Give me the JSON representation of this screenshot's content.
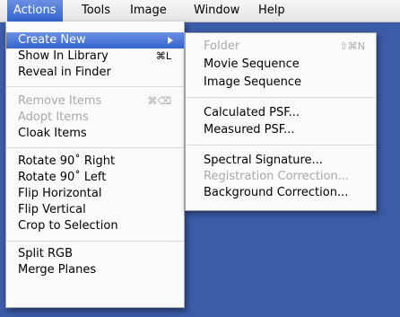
{
  "menubar": {
    "items": [
      "Actions",
      "Tools",
      "Image",
      "Window",
      "Help"
    ]
  },
  "actions_menu": {
    "items": [
      {
        "label": "Create New",
        "shortcut": ""
      },
      {
        "label": "Show In Library",
        "shortcut": "⌘L"
      },
      {
        "label": "Reveal in Finder",
        "shortcut": ""
      },
      {
        "label": "Remove Items",
        "shortcut": "⌘⌫"
      },
      {
        "label": "Adopt Items",
        "shortcut": ""
      },
      {
        "label": "Cloak Items",
        "shortcut": ""
      },
      {
        "label": "Rotate 90˚ Right",
        "shortcut": ""
      },
      {
        "label": "Rotate 90˚ Left",
        "shortcut": ""
      },
      {
        "label": "Flip Horizontal",
        "shortcut": ""
      },
      {
        "label": "Flip Vertical",
        "shortcut": ""
      },
      {
        "label": "Crop to Selection",
        "shortcut": ""
      },
      {
        "label": "Split RGB",
        "shortcut": ""
      },
      {
        "label": "Merge Planes",
        "shortcut": ""
      }
    ]
  },
  "create_new_submenu": {
    "items": [
      {
        "label": "Folder",
        "shortcut": "⇧⌘N"
      },
      {
        "label": "Movie Sequence",
        "shortcut": ""
      },
      {
        "label": "Image Sequence",
        "shortcut": ""
      },
      {
        "label": "Calculated PSF...",
        "shortcut": ""
      },
      {
        "label": "Measured PSF...",
        "shortcut": ""
      },
      {
        "label": "Spectral Signature...",
        "shortcut": ""
      },
      {
        "label": "Registration Correction...",
        "shortcut": ""
      },
      {
        "label": "Background Correction...",
        "shortcut": ""
      }
    ]
  },
  "colors": {
    "highlight": "#3466cf",
    "desktop": "#3d5ca8",
    "disabled_text": "#a9a9a9"
  },
  "icons": {
    "submenu_indicator": "triangle-right-icon"
  }
}
